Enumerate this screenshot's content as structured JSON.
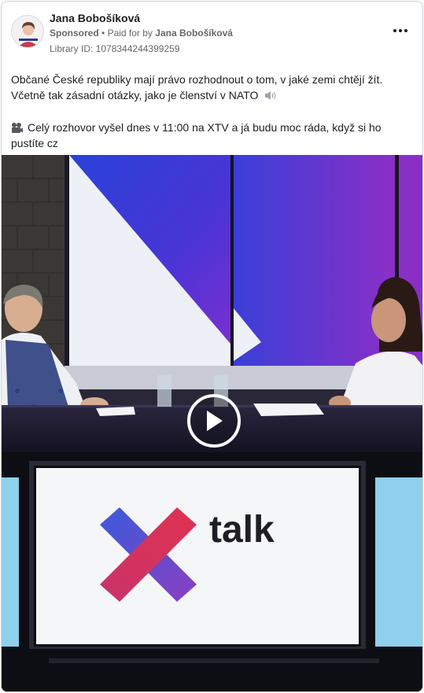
{
  "advertiser": {
    "name": "Jana Bobošíková",
    "sponsored_label": "Sponsored",
    "paid_for_label": "Paid for by",
    "paid_for_name": "Jana Bobošíková",
    "library_id": "Library ID: 1078344244399259"
  },
  "post": {
    "line1": "Občané České republiky mají právo rozhodnout o tom, v jaké zemi chtějí žít. Včetně tak zásadní otázky, jako je členství v NATO",
    "line2": "Celý rozhovor vyšel dnes v 11:00 na XTV a já budu moc ráda, když si ho pustíte cz"
  },
  "video": {
    "logo_text": "talk"
  },
  "colors": {
    "text": "#1c1e21",
    "secondary_text": "#65676b",
    "studio_blue": "#2a42d8",
    "studio_purple": "#7a2fd0",
    "logo_blue": "#3b5bdb",
    "logo_red": "#e03150"
  },
  "icons": {
    "menu": "more-dots-icon",
    "speaker": "speaker-icon",
    "camera": "video-camera-icon",
    "play": "play-icon"
  }
}
